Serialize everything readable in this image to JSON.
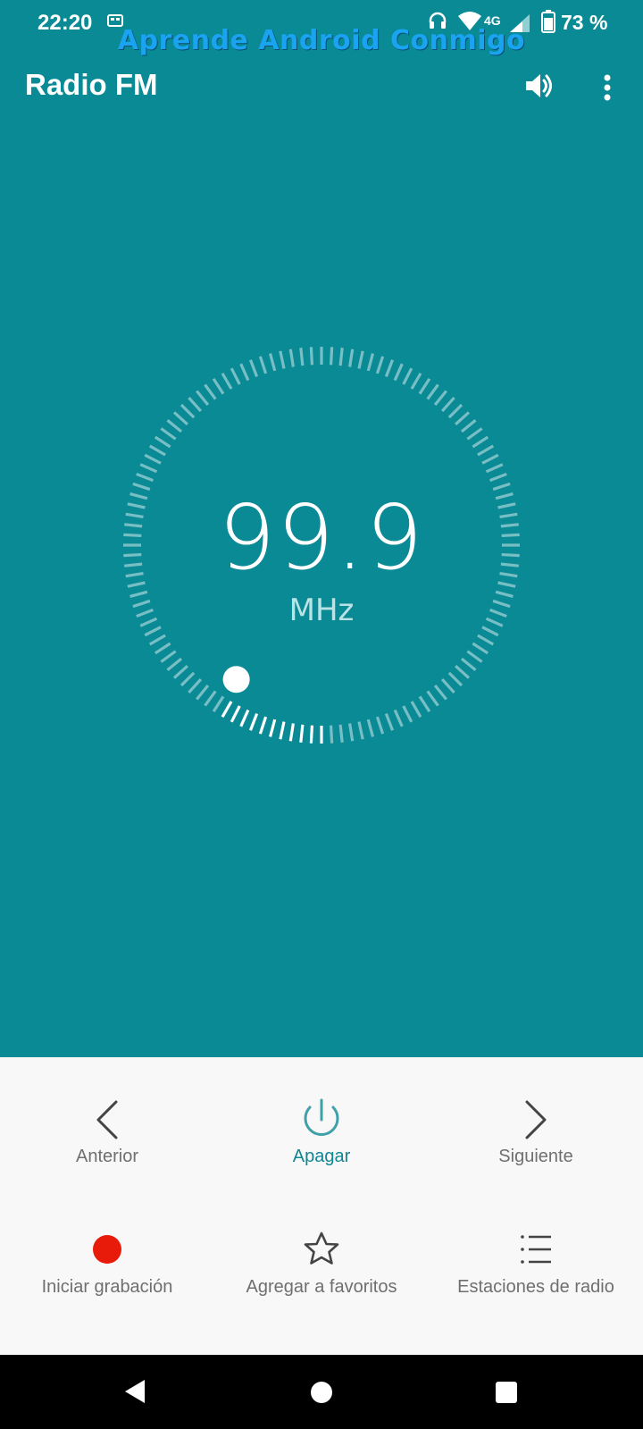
{
  "status_bar": {
    "time": "22:20",
    "network": "4G",
    "battery": "73 %",
    "icons": [
      "sim-icon",
      "headphones-icon",
      "wifi-icon",
      "signal-icon",
      "battery-icon"
    ]
  },
  "watermark": "Aprende Android Conmigo",
  "app_bar": {
    "title": "Radio FM",
    "actions": [
      "speaker-icon",
      "more-vert-icon"
    ]
  },
  "tuner": {
    "frequency": "99.9",
    "unit": "MHz",
    "dial_position_fraction": 0.09
  },
  "controls": {
    "previous": {
      "label": "Anterior",
      "icon": "chevron-left-icon"
    },
    "power": {
      "label": "Apagar",
      "icon": "power-icon"
    },
    "next": {
      "label": "Siguiente",
      "icon": "chevron-right-icon"
    },
    "record": {
      "label": "Iniciar grabación",
      "icon": "record-dot-icon"
    },
    "favorite": {
      "label": "Agregar a favoritos",
      "icon": "star-outline-icon"
    },
    "stations": {
      "label": "Estaciones de radio",
      "icon": "list-icon"
    }
  },
  "colors": {
    "primary": "#0a8a95",
    "accent": "#0f8692",
    "record": "#e81a0a",
    "panel": "#f8f8f8"
  },
  "nav_bar": {
    "buttons": [
      "back-icon",
      "home-icon",
      "recents-icon"
    ]
  }
}
